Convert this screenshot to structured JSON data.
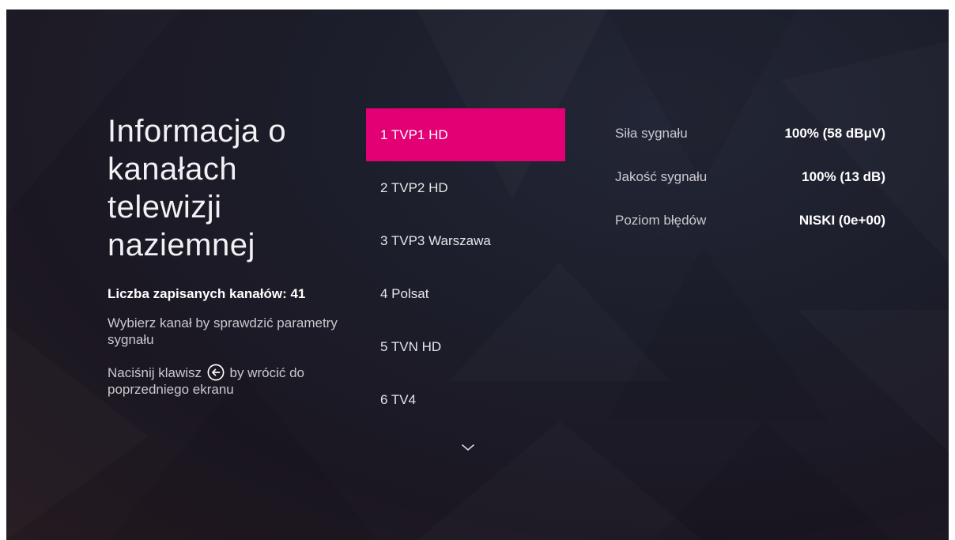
{
  "title": "Informacja o kanałach telewizji naziemnej",
  "saved_channels": "Liczba zapisanych kanałów: 41",
  "hint_select": "Wybierz kanał by sprawdzić parametry sygnału",
  "hint_back_before": "Naciśnij klawisz",
  "hint_back_after": "by wrócić do poprzedniego ekranu",
  "channels": [
    {
      "label": "1 TVP1 HD",
      "selected": true
    },
    {
      "label": "2 TVP2 HD",
      "selected": false
    },
    {
      "label": "3 TVP3 Warszawa",
      "selected": false
    },
    {
      "label": "4 Polsat",
      "selected": false
    },
    {
      "label": "5 TVN HD",
      "selected": false
    },
    {
      "label": "6 TV4",
      "selected": false
    }
  ],
  "signal": [
    {
      "label": "Siła sygnału",
      "value": "100% (58 dBμV)"
    },
    {
      "label": "Jakość sygnału",
      "value": "100% (13 dB)"
    },
    {
      "label": "Poziom błędów",
      "value": "NISKI (0e+00)"
    }
  ],
  "icons": {
    "back": "back-arrow-circle-icon",
    "scroll": "chevron-down-icon"
  },
  "colors": {
    "accent": "#e20074",
    "background": "#1c1e2b"
  }
}
